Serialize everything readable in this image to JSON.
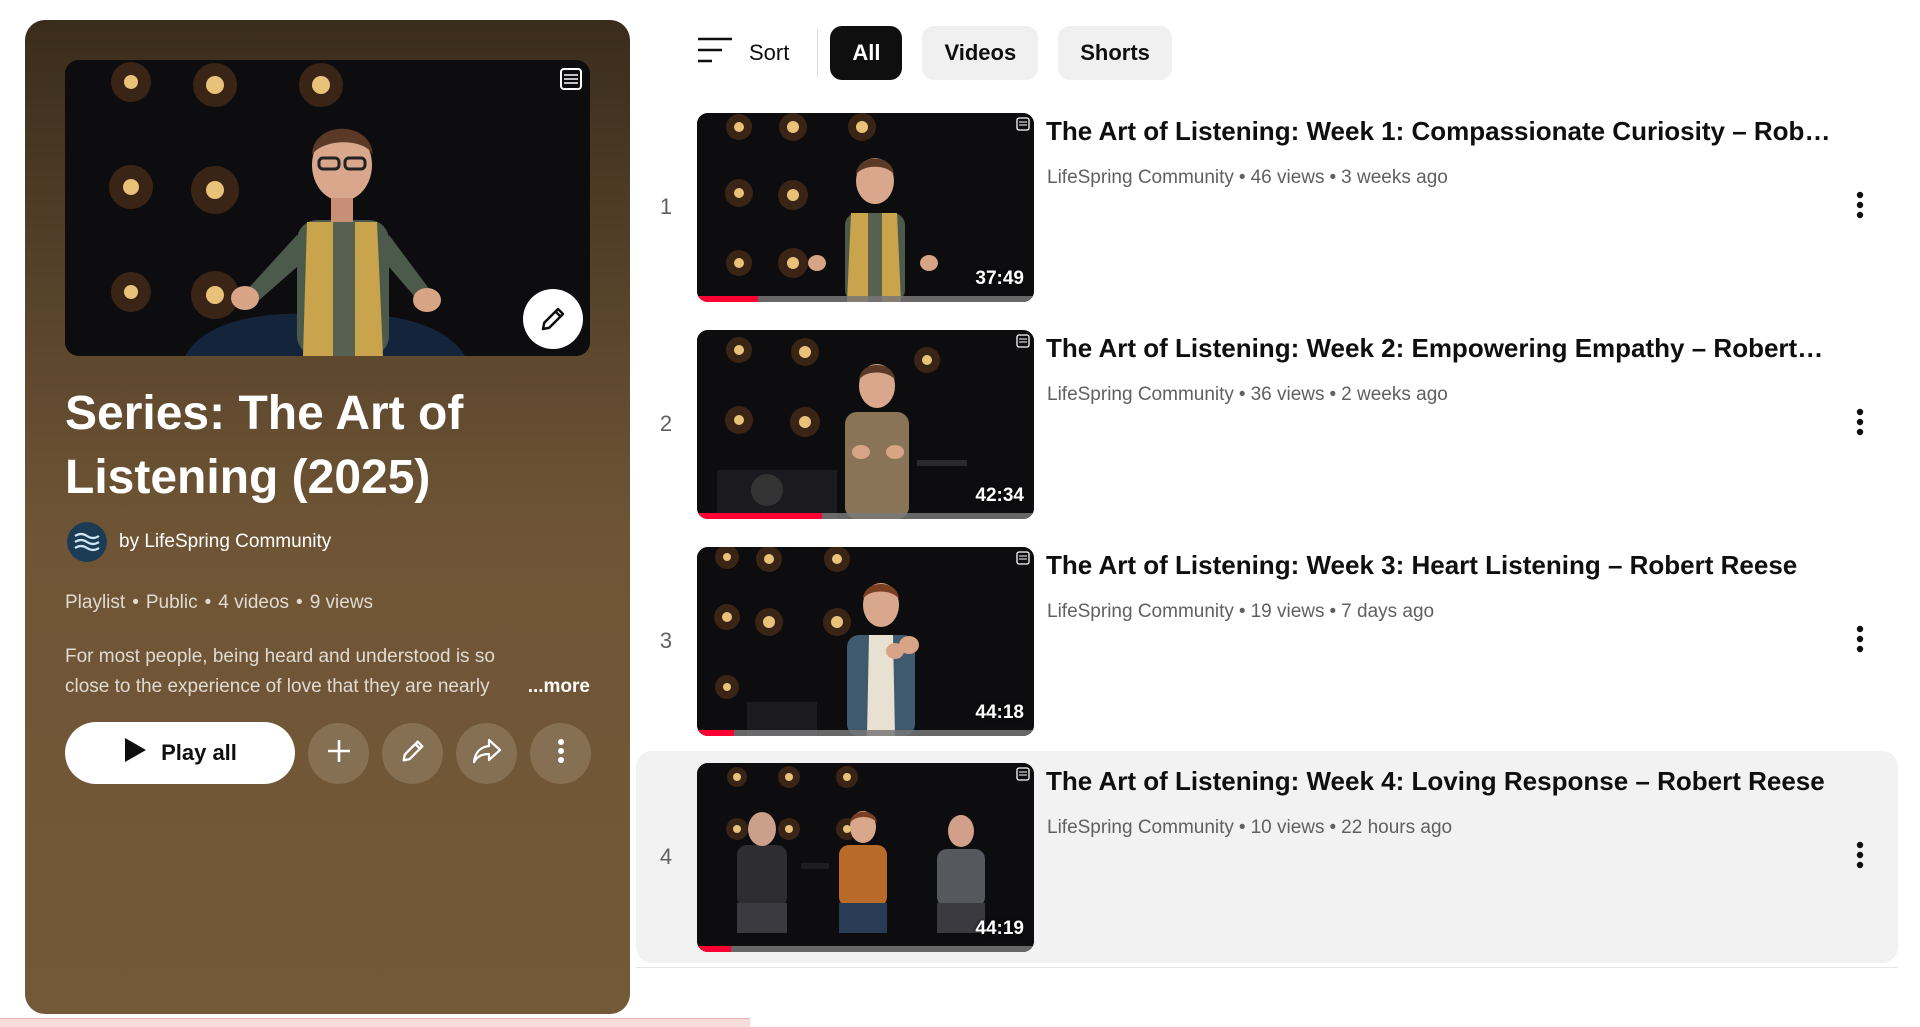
{
  "playlist": {
    "title": "Series: The Art of Listening (2025)",
    "owner": "by LifeSpring Community",
    "meta": {
      "type": "Playlist",
      "visibility": "Public",
      "count": "4 videos",
      "views": "9 views"
    },
    "description": "For most people, being heard and understood is so close to the experience of love that they are nearly",
    "more_label": "...more",
    "play_all_label": "Play all",
    "colors": {
      "panel_top": "#3a2c1c",
      "panel_bottom": "#735937"
    }
  },
  "filters": {
    "sort_label": "Sort",
    "chips": [
      {
        "label": "All",
        "active": true
      },
      {
        "label": "Videos",
        "active": false
      },
      {
        "label": "Shorts",
        "active": false
      }
    ]
  },
  "videos": [
    {
      "index": "1",
      "title": "The Art of Listening: Week 1: Compassionate Curiosity – Rober…",
      "channel": "LifeSpring Community",
      "views": "46 views",
      "age": "3 weeks ago",
      "duration": "37:49",
      "watched_fraction": 0.18
    },
    {
      "index": "2",
      "title": "The Art of Listening: Week 2: Empowering Empathy – Robert…",
      "channel": "LifeSpring Community",
      "views": "36 views",
      "age": "2 weeks ago",
      "duration": "42:34",
      "watched_fraction": 0.37
    },
    {
      "index": "3",
      "title": "The Art of Listening: Week 3: Heart Listening – Robert Reese",
      "channel": "LifeSpring Community",
      "views": "19 views",
      "age": "7 days ago",
      "duration": "44:18",
      "watched_fraction": 0.11
    },
    {
      "index": "4",
      "title": "The Art of Listening: Week 4: Loving Response – Robert Reese",
      "channel": "LifeSpring Community",
      "views": "10 views",
      "age": "22 hours ago",
      "duration": "44:19",
      "watched_fraction": 0.1
    }
  ],
  "icons": {
    "sort": "sort-lines-icon",
    "play": "play-triangle-icon",
    "save": "plus-icon",
    "edit": "pencil-icon",
    "share": "share-arrow-icon",
    "more": "vertical-dots-icon",
    "playlist_badge": "playlist-stack-icon"
  },
  "accent_color": "#ff0033"
}
